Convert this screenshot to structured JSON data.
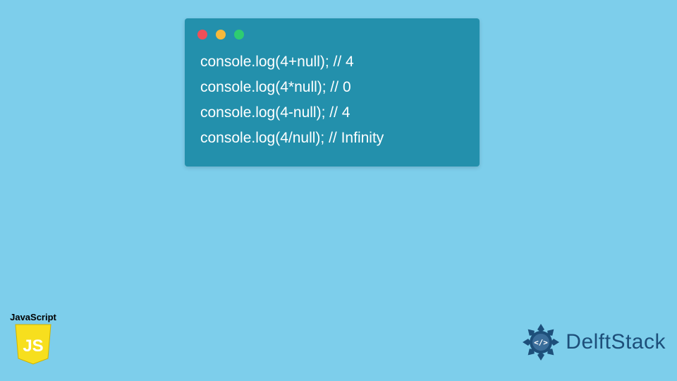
{
  "code": {
    "lines": [
      "console.log(4+null); // 4",
      "console.log(4*null); // 0",
      "console.log(4-null); // 4",
      "console.log(4/null); // Infinity"
    ]
  },
  "js_badge": {
    "label": "JavaScript",
    "shield_text": "JS"
  },
  "delftstack": {
    "text": "DelftStack",
    "icon_glyph": "</>"
  },
  "colors": {
    "page_bg": "#7dceeb",
    "window_bg": "#2390ac",
    "code_text": "#ffffff",
    "dot_red": "#ee4f58",
    "dot_yellow": "#f6b93b",
    "dot_green": "#2ecc71",
    "js_yellow": "#f7df1e",
    "delft_blue": "#1d4f7a"
  }
}
